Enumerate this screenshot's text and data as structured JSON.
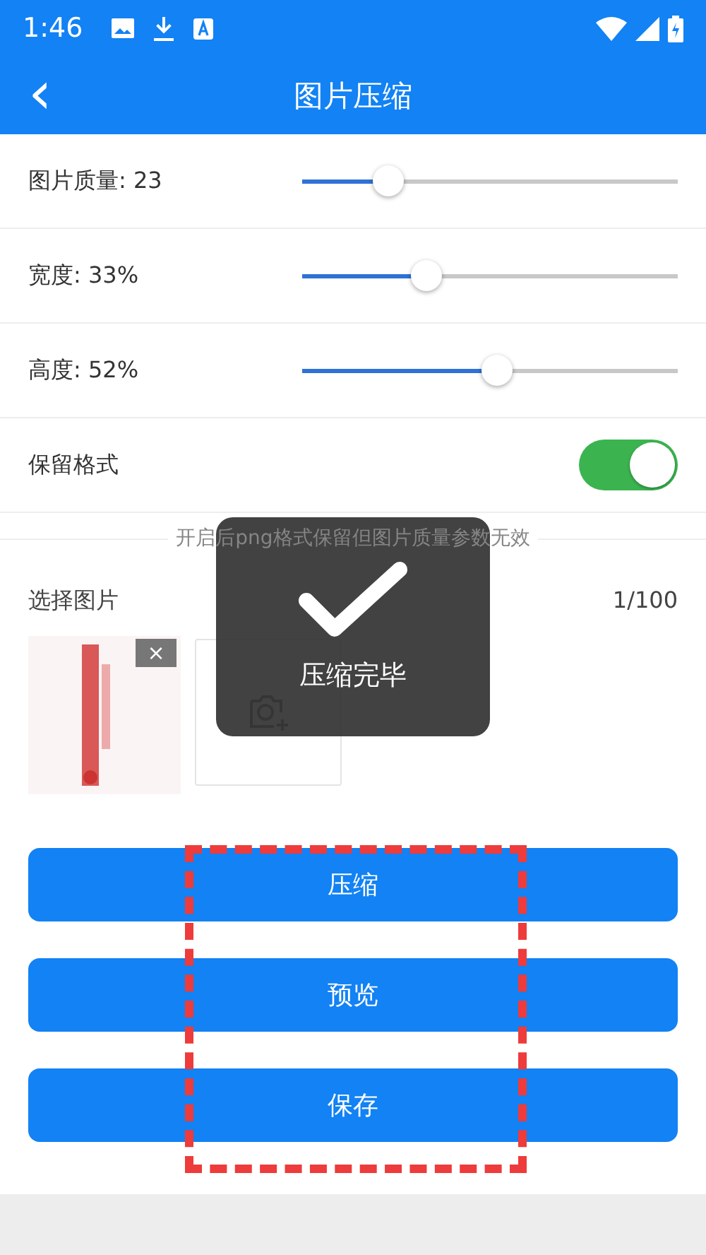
{
  "status_bar": {
    "time": "1:46"
  },
  "title_bar": {
    "back": "‹",
    "title": "图片压缩"
  },
  "settings": [
    {
      "kind": "slider",
      "label": "图片质量: 23",
      "level": 0.23
    },
    {
      "kind": "slider",
      "label": "宽度: 33%",
      "level": 0.33
    },
    {
      "kind": "slider",
      "label": "高度: 52%",
      "level": 0.52
    },
    {
      "kind": "switch",
      "label": "保留格式",
      "on": true
    }
  ],
  "hint": "开启后png格式保留但图片质量参数无效",
  "picker": {
    "label": "选择图片",
    "count": "1/100",
    "images": [
      {
        "kind": "picture",
        "remove": "×"
      }
    ]
  },
  "buttons": [
    "压缩",
    "预览",
    "保存"
  ],
  "toast": {
    "message": "压缩完毕"
  },
  "highlight": {
    "shown": true
  }
}
